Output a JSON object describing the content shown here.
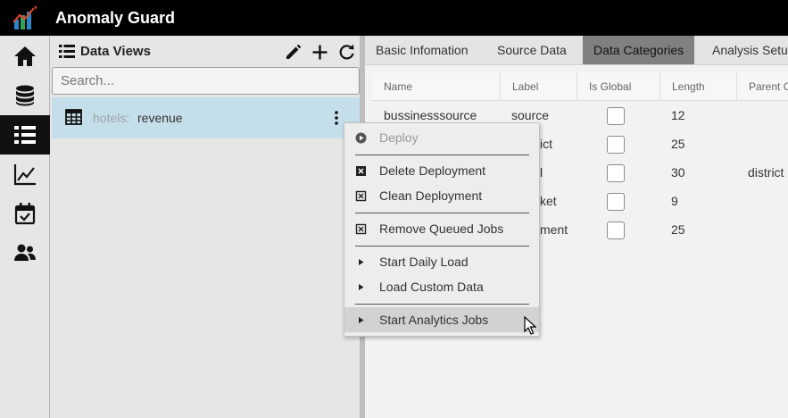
{
  "app": {
    "title": "Anomaly Guard"
  },
  "rail": {
    "items": [
      {
        "icon": "home-icon"
      },
      {
        "icon": "database-icon"
      },
      {
        "icon": "list-icon",
        "active": true
      },
      {
        "icon": "chart-line-icon"
      },
      {
        "icon": "calendar-check-icon"
      },
      {
        "icon": "users-icon"
      }
    ]
  },
  "views": {
    "title": "Data Views",
    "search_placeholder": "Search...",
    "item": {
      "prefix": "hotels:",
      "name": "revenue"
    }
  },
  "tabs": [
    "Basic Infomation",
    "Source Data",
    "Data Categories",
    "Analysis Setu"
  ],
  "active_tab": "Data Categories",
  "grid": {
    "columns": [
      "Name",
      "Label",
      "Is Global",
      "Length",
      "Parent C"
    ],
    "rows": [
      {
        "name": "bussinesssource",
        "label": "source",
        "is_global": false,
        "length": "12",
        "parent": ""
      },
      {
        "name": "",
        "label": "ict",
        "is_global": false,
        "length": "25",
        "parent": ""
      },
      {
        "name": "",
        "label": "l",
        "is_global": false,
        "length": "30",
        "parent": "district"
      },
      {
        "name": "",
        "label": "ket",
        "is_global": false,
        "length": "9",
        "parent": ""
      },
      {
        "name": "",
        "label": "ment",
        "is_global": false,
        "length": "25",
        "parent": ""
      }
    ]
  },
  "menu": {
    "deploy": "Deploy",
    "delete_deployment": "Delete Deployment",
    "clean_deployment": "Clean Deployment",
    "remove_queued_jobs": "Remove Queued Jobs",
    "start_daily_load": "Start Daily Load",
    "load_custom_data": "Load Custom Data",
    "start_analytics_jobs": "Start Analytics Jobs"
  },
  "colors": {
    "topbar": "#000000",
    "selected_view": "#c5dfea",
    "active_tab": "#808080",
    "menu_hover": "#d2d2d2"
  }
}
